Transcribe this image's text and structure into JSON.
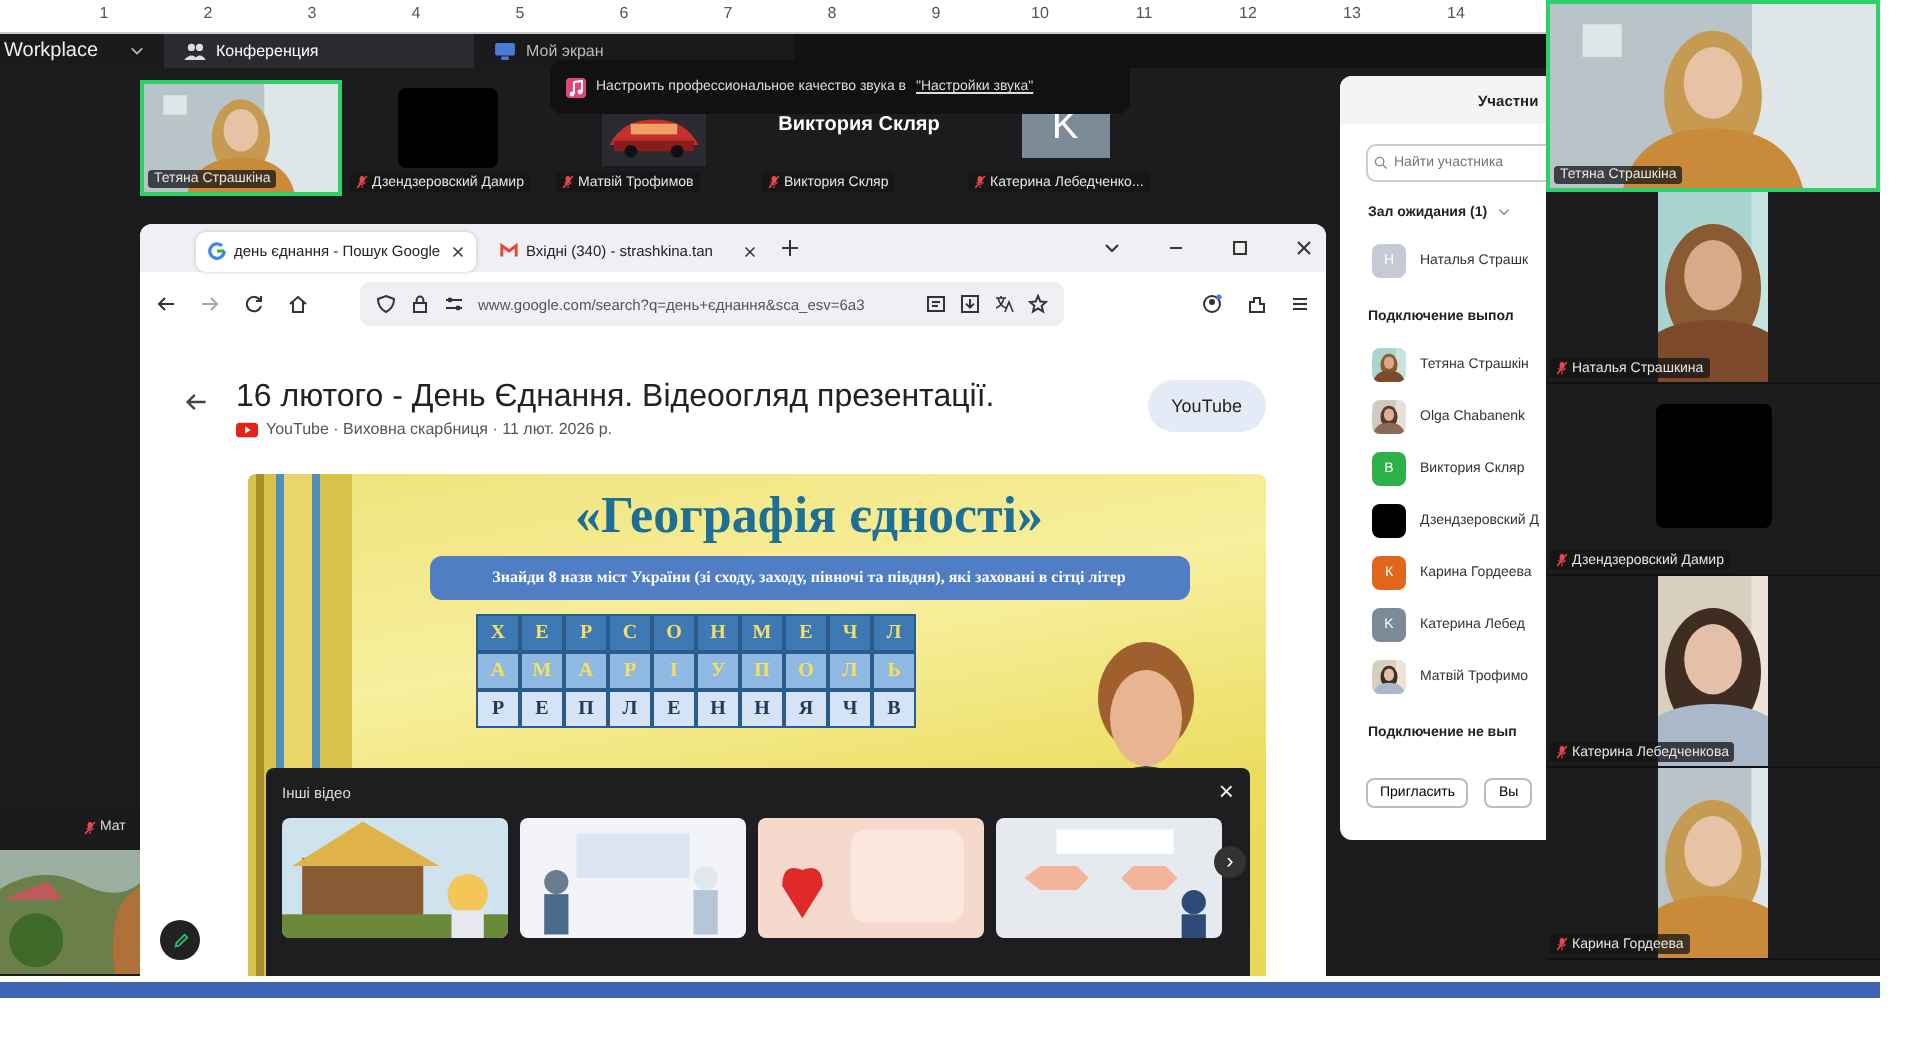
{
  "ruler": [
    "1",
    "2",
    "3",
    "4",
    "5",
    "6",
    "7",
    "8",
    "9",
    "10",
    "11",
    "12",
    "13",
    "14"
  ],
  "app_tabs": [
    {
      "label": "Workplace",
      "selected": false,
      "kind": "menu"
    },
    {
      "label": "Конференция",
      "selected": true,
      "kind": "meeting"
    },
    {
      "label": "Мой экран",
      "selected": false,
      "kind": "screen"
    }
  ],
  "toast": {
    "text": "Настроить профессиональное качество звука в",
    "link": "\"Настройки звука\""
  },
  "gallery": [
    {
      "name": "Тетяна Страшкіна",
      "kind": "video",
      "speaking": true,
      "muted": false
    },
    {
      "name": "Дзендзеровский Дамир",
      "kind": "dark",
      "speaking": false,
      "muted": true
    },
    {
      "name": "Матвій Трофимов",
      "kind": "car",
      "speaking": false,
      "muted": true
    },
    {
      "name": "Виктория Скляр",
      "kind": "name",
      "display": "Виктория Скляр",
      "speaking": false,
      "muted": true
    },
    {
      "name": "Катерина Лебедченко...",
      "kind": "letter",
      "letter": "K",
      "speaking": false,
      "muted": true
    }
  ],
  "browser": {
    "tabs": [
      {
        "title": "день єднання - Пошук Google",
        "selected": true
      },
      {
        "title": "Вхідні (340) - strashkina.tan",
        "selected": false
      }
    ],
    "url": "www.google.com/search?q=день+єднання&sca_esv=6a3",
    "result": {
      "title": "16 лютого - День Єднання. Відеоогляд презентації.",
      "source": "YouTube · Виховна скарбниця · 11 лют. 2026 р.",
      "chip": "YouTube",
      "slide": {
        "title": "«Географія єдності»",
        "instruction": "Знайди 8 назв міст України (зі сходу, заходу, півночі та півдня), які заховані в сітці літер",
        "grid": [
          [
            "Х",
            "Е",
            "Р",
            "С",
            "О",
            "Н",
            "М",
            "Е",
            "Ч",
            "Л"
          ],
          [
            "А",
            "М",
            "А",
            "Р",
            "І",
            "У",
            "П",
            "О",
            "Л",
            "Ь"
          ],
          [
            "Р",
            "Е",
            "П",
            "Л",
            "Е",
            "Н",
            "Н",
            "Я",
            "Ч",
            "В"
          ]
        ]
      },
      "more_videos": {
        "title": "Інші відео",
        "close": "×",
        "next": "›"
      }
    }
  },
  "participants": {
    "title": "Участни",
    "search_placeholder": "Найти участника",
    "waiting": {
      "label": "Зал ожидания (1)",
      "people": [
        {
          "name": "Наталья Страшк",
          "letter": "Н",
          "color": "#c5cad6"
        }
      ]
    },
    "sections": [
      {
        "label": "Подключение выпол",
        "people": [
          {
            "name": "Тетяна Страшкін"
          },
          {
            "name": "Olga Chabanenk"
          },
          {
            "name": "Виктория Скляр",
            "letter": "В",
            "color": "#2db14b"
          },
          {
            "name": "Дзендзеровский Д",
            "color": "#000000"
          },
          {
            "name": "Карина Гордеева",
            "letter": "К",
            "color": "#e0661c"
          },
          {
            "name": "Катерина Лебед",
            "letter": "K",
            "color": "#7d8b99"
          },
          {
            "name": "Матвій Трофимо"
          }
        ]
      },
      {
        "label": "Подключение не вып"
      }
    ],
    "buttons": [
      "Пригласить",
      "Вы"
    ]
  },
  "right_tiles": [
    {
      "name": "Тетяна Страшкіна",
      "kind": "video",
      "speaking": true,
      "muted": false
    },
    {
      "name": "Наталья Страшкина",
      "kind": "portrait",
      "speaking": false,
      "muted": true
    },
    {
      "name": "Дзендзеровский Дамир",
      "kind": "dark",
      "speaking": false,
      "muted": true
    },
    {
      "name": "Катерина Лебедченкова",
      "kind": "portrait",
      "speaking": false,
      "muted": true
    },
    {
      "name": "Карина Гордеева",
      "kind": "portrait",
      "speaking": false,
      "muted": true
    }
  ],
  "corner_tile": {
    "name": "Мат",
    "muted": true
  }
}
